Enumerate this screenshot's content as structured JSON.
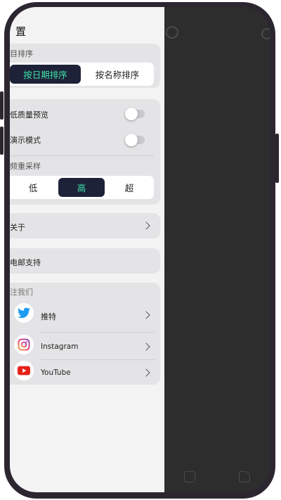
{
  "header": {
    "title": "置"
  },
  "sort": {
    "label": "目排序",
    "options": [
      "按日期排序",
      "按名称排序"
    ],
    "selected": "按日期排序"
  },
  "preview": {
    "low_quality_label": "低质量预览",
    "low_quality_on": false,
    "demo_mode_label": "演示模式",
    "demo_mode_on": false,
    "resample_label": "频重采样",
    "resample_options": [
      "低",
      "高",
      "超"
    ],
    "resample_selected": "高"
  },
  "about": {
    "label": "关于"
  },
  "email": {
    "label": "电邮支持"
  },
  "follow": {
    "label": "注我们",
    "items": [
      {
        "label": "推特",
        "icon": "twitter-bird-icon"
      },
      {
        "label": "Instagram",
        "icon": "instagram-icon"
      },
      {
        "label": "YouTube",
        "icon": "youtube-icon"
      }
    ]
  },
  "colors": {
    "accent_dark": "#1e2238",
    "accent_text": "#3ce0a8",
    "twitter": "#1d9bf0",
    "youtube": "#e62117"
  }
}
